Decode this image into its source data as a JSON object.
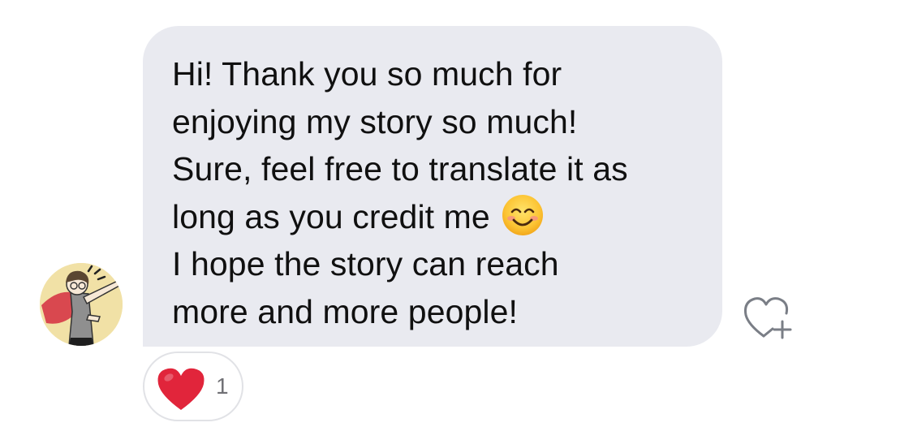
{
  "message": {
    "lines": [
      "Hi! Thank you so much for",
      "enjoying my story so much!",
      "Sure, feel free to translate it as",
      "long as you credit me",
      "I hope the story can reach",
      "more and more people!"
    ],
    "emoji": "smiling-face-with-smiling-eyes",
    "bubble_color": "#e9eaf0",
    "text_color": "#101010"
  },
  "sender": {
    "avatar_icon": "avatar-illustration"
  },
  "actions": {
    "react_icon": "heart-plus-icon"
  },
  "reactions": [
    {
      "icon": "red-heart",
      "color": "#e1253b",
      "count": "1"
    }
  ]
}
